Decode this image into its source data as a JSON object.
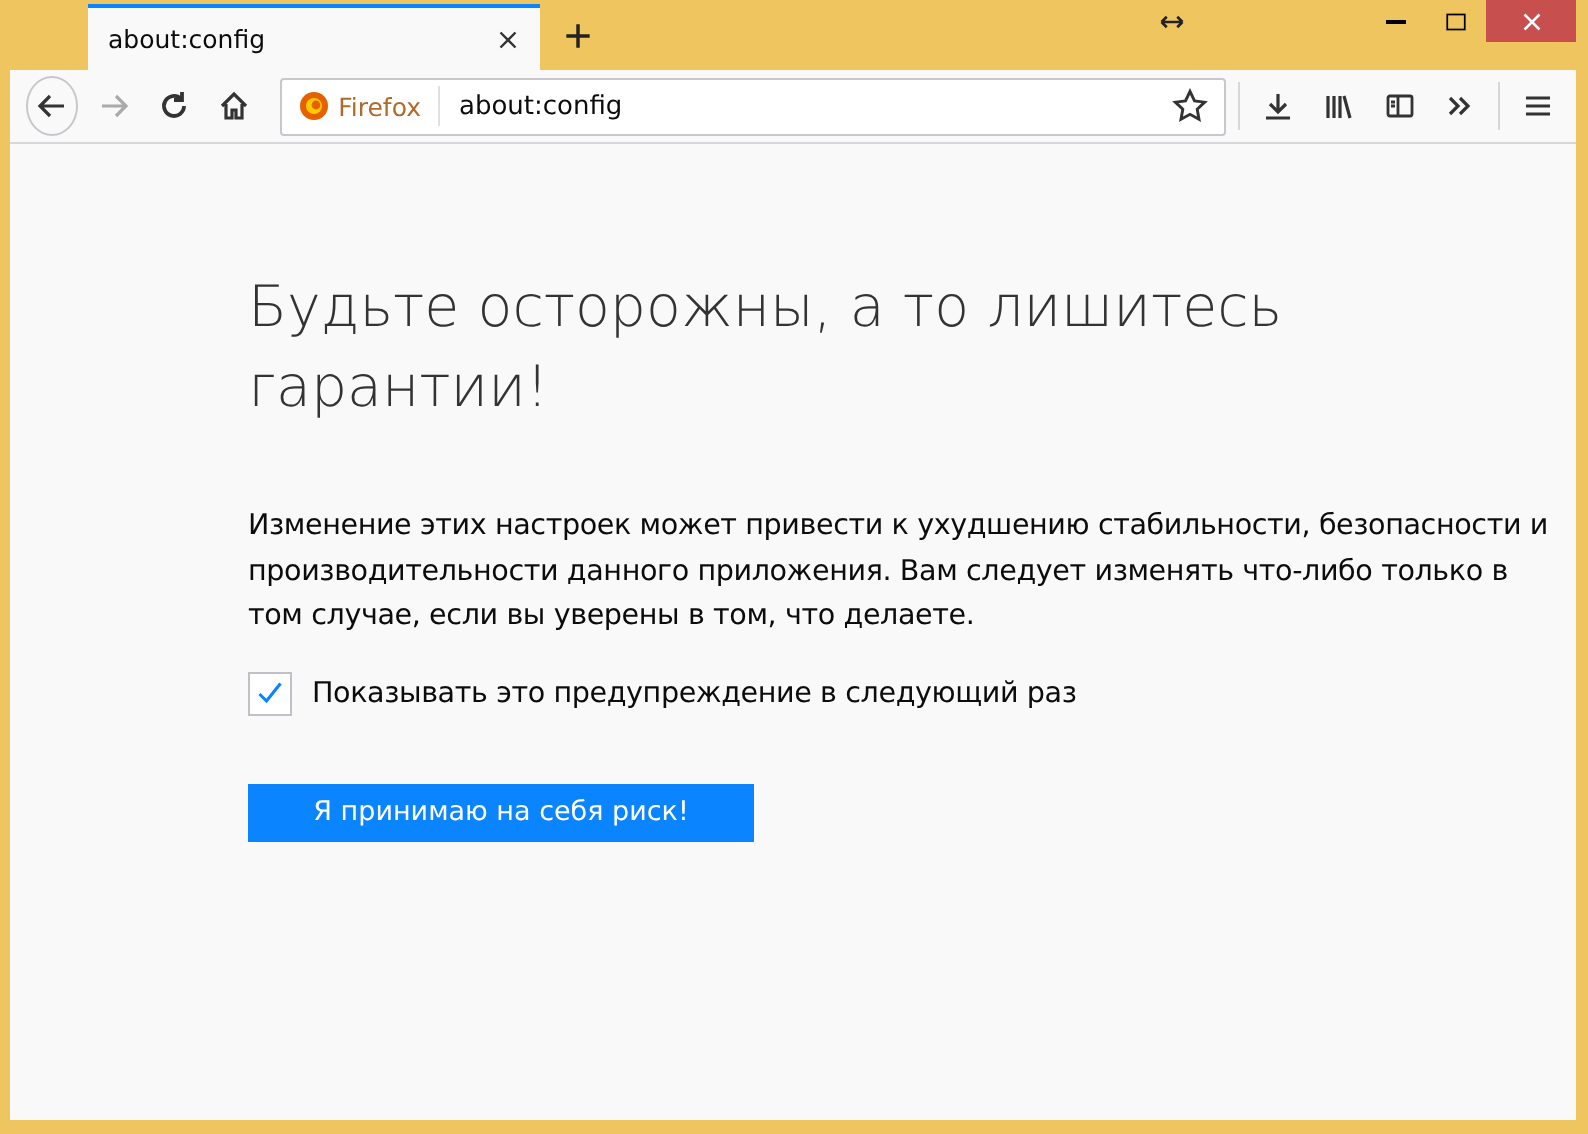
{
  "tabs": [
    {
      "title": "about:config",
      "selected": true
    }
  ],
  "new_tab": "+",
  "address_bar": {
    "identity": "Firefox",
    "url": "about:config"
  },
  "page": {
    "heading": "Будьте осторожны, а то лишитесь гарантии!",
    "description": "Изменение этих настроек может привести к ухудшению стабильности, безопасности и производительности данного приложения. Вам следует изменять что-либо только в том случае, если вы уверены в том, что делаете.",
    "checkbox": {
      "label": "Показывать это предупреждение в следующий раз",
      "checked": true
    },
    "button": "Я принимаю на себя риск!"
  }
}
